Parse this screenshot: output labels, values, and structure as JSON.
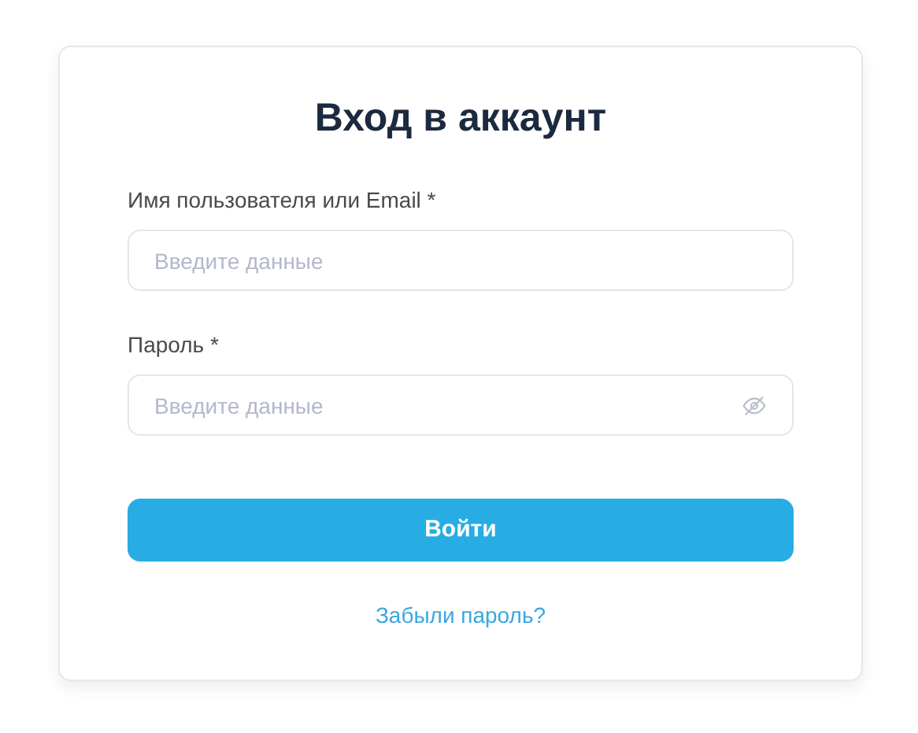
{
  "title": "Вход в аккаунт",
  "fields": [
    {
      "kind": "text",
      "label": "Имя пользователя или Email *",
      "placeholder": "Введите данные"
    },
    {
      "kind": "password",
      "label": "Пароль *",
      "placeholder": "Введите данные"
    }
  ],
  "submit": "Войти",
  "forgot_link": "Забыли пароль?"
}
